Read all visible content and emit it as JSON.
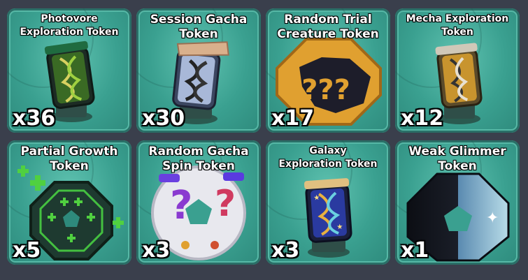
{
  "tokens": [
    {
      "name": "Photovore\nExploration Token",
      "count": "x36",
      "icon": "dna-capsule-icon"
    },
    {
      "name": "Session Gacha\nToken",
      "count": "x30",
      "icon": "dna-capsule-icon"
    },
    {
      "name": "Random Trial\nCreature Token",
      "count": "x17",
      "icon": "mystery-octagon-icon"
    },
    {
      "name": "Mecha Exploration\nToken",
      "count": "x12",
      "icon": "dna-capsule-icon"
    },
    {
      "name": "Partial Growth\nToken",
      "count": "x5",
      "icon": "growth-octagon-icon"
    },
    {
      "name": "Random Gacha\nSpin Token",
      "count": "x3",
      "icon": "question-ring-icon"
    },
    {
      "name": "Galaxy\nExploration Token",
      "count": "x3",
      "icon": "dna-capsule-icon"
    },
    {
      "name": "Weak Glimmer\nToken",
      "count": "x1",
      "icon": "glimmer-octagon-icon"
    }
  ]
}
